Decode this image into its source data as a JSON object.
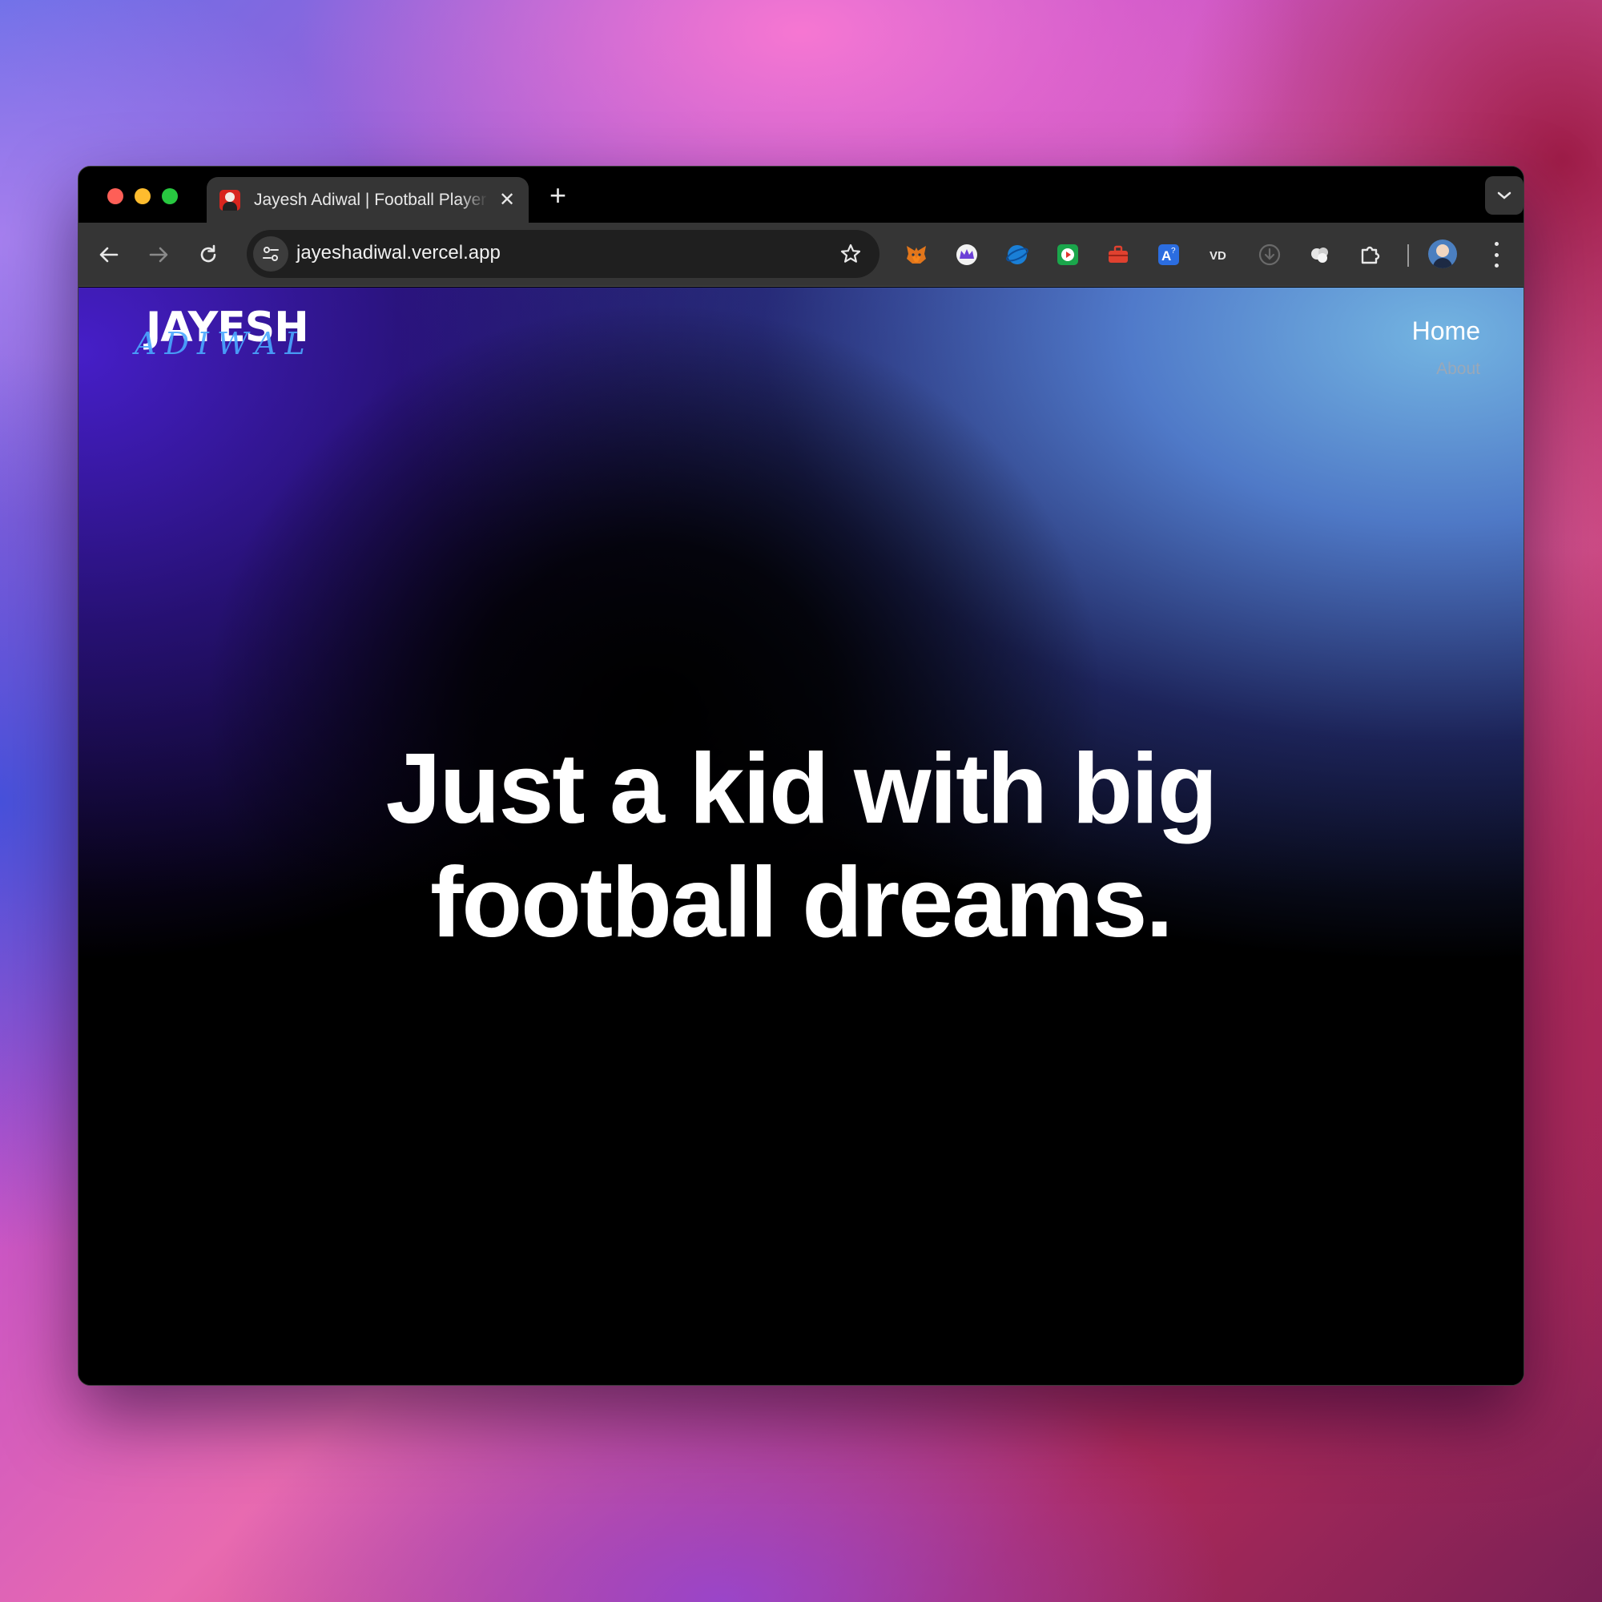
{
  "browser": {
    "tab": {
      "title": "Jayesh Adiwal | Football Player",
      "close_icon": "close-icon"
    },
    "new_tab_icon": "plus-icon",
    "tab_menu_icon": "chevron-down-icon",
    "toolbar": {
      "back_icon": "arrow-left-icon",
      "forward_icon": "arrow-right-icon",
      "reload_icon": "reload-icon",
      "site_info_icon": "tune-icon",
      "url": "jayeshadiwal.vercel.app",
      "bookmark_icon": "star-icon",
      "extensions": [
        "metamask-fox-icon",
        "crown-extension-icon",
        "blue-orb-extension-icon",
        "green-play-extension-icon",
        "red-toolbox-extension-icon",
        "blue-translate-extension-icon",
        "vd-extension-icon",
        "grey-download-extension-icon",
        "white-cloud-extension-icon",
        "puzzle-piece-icon"
      ],
      "profile_icon": "profile-avatar-icon",
      "menu_icon": "kebab-menu-icon"
    }
  },
  "page": {
    "logo": {
      "main": "JAYESH",
      "signature": "ADIWAL"
    },
    "nav": {
      "home": "Home",
      "about": "About"
    },
    "hero": {
      "line1": "Just a kid with big",
      "line2": "football dreams."
    }
  },
  "colors": {
    "tab_active": "#353535",
    "toolbar": "#353535",
    "omnibox": "#1f1f1f",
    "nav_about": "#9aa8b8",
    "logo_signature": "#4aa8ff"
  }
}
